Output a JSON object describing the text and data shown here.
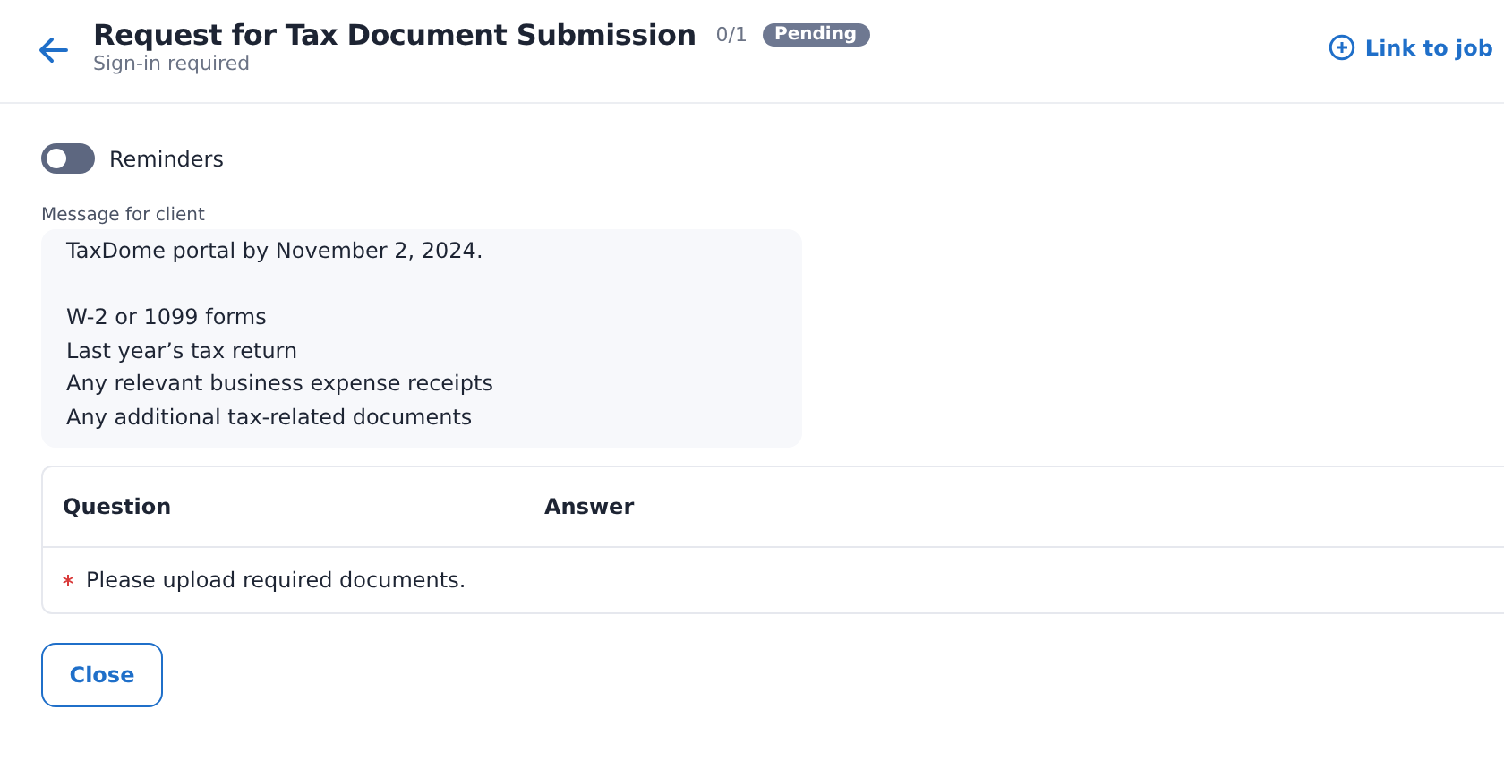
{
  "header": {
    "title": "Request for Tax Document Submission",
    "subtitle": "Sign-in required",
    "progress": "0/1",
    "status": "Pending",
    "link": "Link to job"
  },
  "reminders": {
    "label": "Reminders",
    "on": false
  },
  "message": {
    "label": "Message for client",
    "lines": [
      "TaxDome portal by November 2, 2024.",
      "W-2 or 1099 forms",
      "Last year’s tax return",
      "Any relevant business expense receipts",
      "Any additional tax-related documents"
    ]
  },
  "table": {
    "columns": [
      "Question",
      "Answer"
    ],
    "rows": [
      {
        "question": "Please upload required documents.",
        "required": true
      }
    ]
  },
  "buttons": [
    "Close"
  ]
}
